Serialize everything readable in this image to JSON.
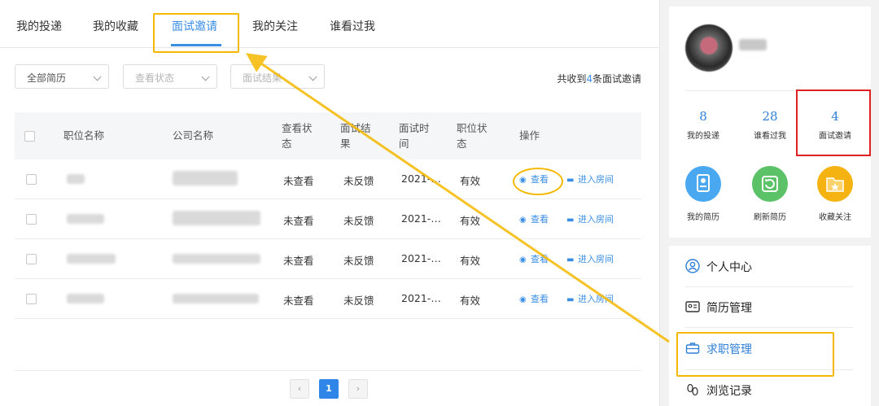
{
  "tabs": [
    {
      "label": "我的投递"
    },
    {
      "label": "我的收藏"
    },
    {
      "label": "面试邀请",
      "active": true
    },
    {
      "label": "我的关注"
    },
    {
      "label": "谁看过我"
    }
  ],
  "filters": {
    "resume": "全部简历",
    "view_status": "查看状态",
    "interview_result": "面试结果"
  },
  "summary": {
    "prefix": "共收到",
    "count": "4",
    "suffix": "条面试邀请"
  },
  "table": {
    "headers": {
      "position": "职位名称",
      "company": "公司名称",
      "view_status": "查看状\n态",
      "interview_result": "面试结\n果",
      "interview_time": "面试时\n间",
      "position_status": "职位状\n态",
      "action": "操作"
    },
    "rows": [
      {
        "view_status": "未查看",
        "result": "未反馈",
        "time": "2021-…",
        "status": "有效",
        "view": "查看",
        "enter": "进入房间"
      },
      {
        "view_status": "未查看",
        "result": "未反馈",
        "time": "2021-…",
        "status": "有效",
        "view": "查看",
        "enter": "进入房间"
      },
      {
        "view_status": "未查看",
        "result": "未反馈",
        "time": "2021-…",
        "status": "有效",
        "view": "查看",
        "enter": "进入房间"
      },
      {
        "view_status": "未查看",
        "result": "未反馈",
        "time": "2021-…",
        "status": "有效",
        "view": "查看",
        "enter": "进入房间"
      }
    ]
  },
  "pagination": {
    "prev": "‹",
    "current": "1",
    "next": "›"
  },
  "profile": {
    "stats": [
      {
        "value": "8",
        "label": "我的投递"
      },
      {
        "value": "28",
        "label": "谁看过我"
      },
      {
        "value": "4",
        "label": "面试邀请"
      }
    ],
    "features": [
      {
        "label": "我的简历",
        "color": "#4aa8f0",
        "icon": "resume-icon"
      },
      {
        "label": "刷新简历",
        "color": "#5cc268",
        "icon": "refresh-icon"
      },
      {
        "label": "收藏关注",
        "color": "#f5b311",
        "icon": "folder-star-icon"
      }
    ]
  },
  "menu": [
    {
      "label": "个人中心",
      "icon": "user-icon"
    },
    {
      "label": "简历管理",
      "icon": "id-card-icon"
    },
    {
      "label": "求职管理",
      "icon": "briefcase-icon",
      "active": true
    },
    {
      "label": "浏览记录",
      "icon": "footprint-icon"
    }
  ],
  "colors": {
    "accent": "#3a8ee6",
    "highlight": "#f5b800",
    "alert": "#e02020"
  }
}
